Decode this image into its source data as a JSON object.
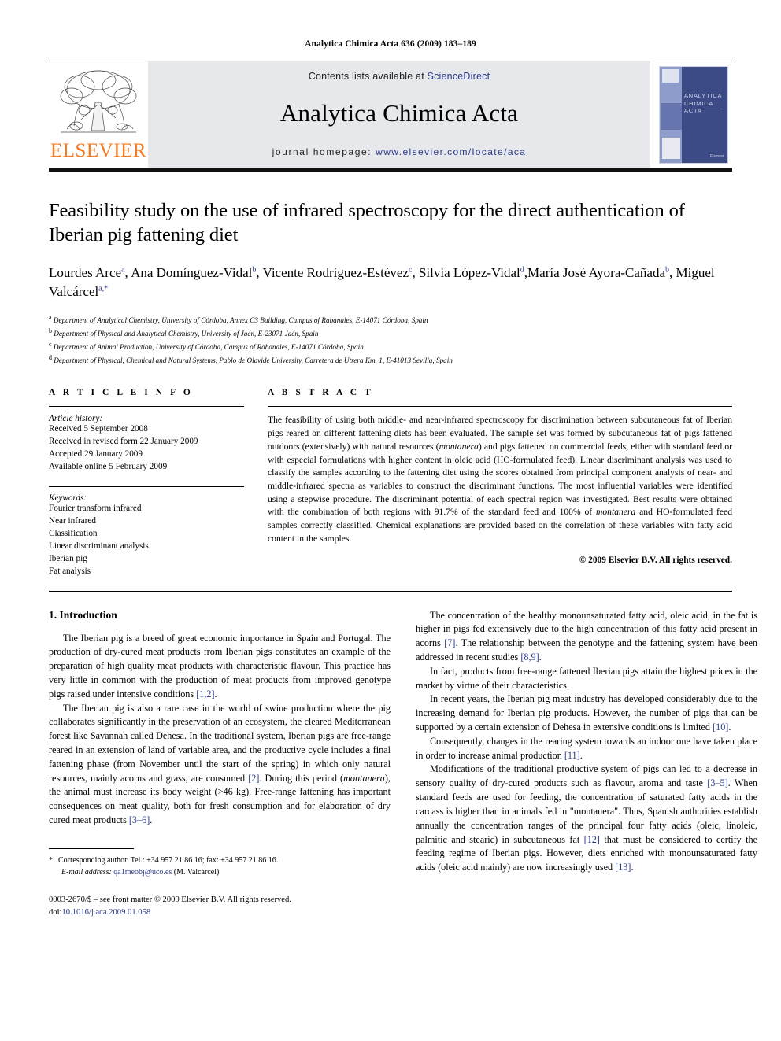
{
  "running_head": "Analytica Chimica Acta 636 (2009) 183–189",
  "masthead": {
    "publisher_wordmark": "ELSEVIER",
    "contents_prefix": "Contents lists available at ",
    "contents_link": "ScienceDirect",
    "journal_title": "Analytica Chimica Acta",
    "homepage_prefix": "journal homepage: ",
    "homepage_url": "www.elsevier.com/locate/aca",
    "cover_title": "ANALYTICA CHIMICA ACTA",
    "cover_brand": "Elsevier"
  },
  "article": {
    "title": "Feasibility study on the use of infrared spectroscopy for the direct authentication of Iberian pig fattening diet",
    "authors": [
      {
        "name": "Lourdes Arce",
        "marks": "a",
        "sep": ", "
      },
      {
        "name": "Ana Domínguez-Vidal",
        "marks": "b",
        "sep": ", "
      },
      {
        "name": "Vicente Rodríguez-Estévez",
        "marks": "c",
        "sep": ", "
      },
      {
        "name": "Silvia López-Vidal",
        "marks": "d",
        "sep": ","
      },
      {
        "name": "María José Ayora-Cañada",
        "marks": "b",
        "sep": ", "
      },
      {
        "name": "Miguel Valcárcel",
        "marks": "a,*",
        "sep": ""
      }
    ],
    "affiliations": [
      {
        "mark": "a",
        "text": "Department of Analytical Chemistry, University of Córdoba, Annex C3 Building, Campus of Rabanales, E-14071 Córdoba, Spain"
      },
      {
        "mark": "b",
        "text": "Department of Physical and Analytical Chemistry, University of Jaén, E-23071 Jaén, Spain"
      },
      {
        "mark": "c",
        "text": "Department of Animal Production, University of Córdoba, Campus of Rabanales, E-14071 Córdoba, Spain"
      },
      {
        "mark": "d",
        "text": "Department of Physical, Chemical and Natural Systems, Pablo de Olavide University, Carretera de Utrera Km. 1, E-41013 Sevilla, Spain"
      }
    ]
  },
  "article_info": {
    "heading": "A R T I C L E    I N F O",
    "history_label": "Article history:",
    "history": [
      "Received 5 September 2008",
      "Received in revised form 22 January 2009",
      "Accepted 29 January 2009",
      "Available online 5 February 2009"
    ],
    "keywords_label": "Keywords:",
    "keywords": [
      "Fourier transform infrared",
      "Near infrared",
      "Classification",
      "Linear discriminant analysis",
      "Iberian pig",
      "Fat analysis"
    ]
  },
  "abstract": {
    "heading": "A B S T R A C T",
    "text_part1": "The feasibility of using both middle- and near-infrared spectroscopy for discrimination between subcutaneous fat of Iberian pigs reared on different fattening diets has been evaluated. The sample set was formed by subcutaneous fat of pigs fattened outdoors (extensively) with natural resources (",
    "italic1": "montanera",
    "text_part2": ") and pigs fattened on commercial feeds, either with standard feed or with especial formulations with higher content in oleic acid (HO-formulated feed). Linear discriminant analysis was used to classify the samples according to the fattening diet using the scores obtained from principal component analysis of near- and middle-infrared spectra as variables to construct the discriminant functions. The most influential variables were identified using a stepwise procedure. The discriminant potential of each spectral region was investigated. Best results were obtained with the combination of both regions with 91.7% of the standard feed and 100% of ",
    "italic2": "montanera",
    "text_part3": " and HO-formulated feed samples correctly classified. Chemical explanations are provided based on the correlation of these variables with fatty acid content in the samples.",
    "copyright": "© 2009 Elsevier B.V. All rights reserved."
  },
  "introduction": {
    "heading": "1.  Introduction",
    "left_paragraphs": [
      {
        "segments": [
          {
            "t": "The Iberian pig is a breed of great economic importance in Spain and Portugal. The production of dry-cured meat products from Iberian pigs constitutes an example of the preparation of high quality meat products with characteristic flavour. This practice has very little in common with the production of meat products from improved genotype pigs raised under intensive conditions ",
            "k": "plain"
          },
          {
            "t": "[1,2]",
            "k": "ref"
          },
          {
            "t": ".",
            "k": "plain"
          }
        ]
      },
      {
        "segments": [
          {
            "t": "The Iberian pig is also a rare case in the world of swine production where the pig collaborates significantly in the preservation of an ecosystem, the cleared Mediterranean forest like Savannah called Dehesa. In the traditional system, Iberian pigs are free-range reared in an extension of land of variable area, and the productive cycle includes a final fattening phase (from November until the start of the spring) in which only natural resources, mainly acorns and grass, are consumed ",
            "k": "plain"
          },
          {
            "t": "[2]",
            "k": "ref"
          },
          {
            "t": ". During this period (",
            "k": "plain"
          },
          {
            "t": "montanera",
            "k": "italic"
          },
          {
            "t": "), the animal must increase its body weight (>46 kg). Free-range fattening has important consequences on meat quality, both for fresh consumption and for elaboration of dry cured meat products ",
            "k": "plain"
          },
          {
            "t": "[3–6]",
            "k": "ref"
          },
          {
            "t": ".",
            "k": "plain"
          }
        ]
      }
    ],
    "right_paragraphs": [
      {
        "segments": [
          {
            "t": "The concentration of the healthy monounsaturated fatty acid, oleic acid, in the fat is higher in pigs fed extensively due to the high concentration of this fatty acid present in acorns ",
            "k": "plain"
          },
          {
            "t": "[7]",
            "k": "ref"
          },
          {
            "t": ". The relationship between the genotype and the fattening system have been addressed in recent studies ",
            "k": "plain"
          },
          {
            "t": "[8,9]",
            "k": "ref"
          },
          {
            "t": ".",
            "k": "plain"
          }
        ]
      },
      {
        "segments": [
          {
            "t": "In fact, products from free-range fattened Iberian pigs attain the highest prices in the market by virtue of their characteristics.",
            "k": "plain"
          }
        ]
      },
      {
        "segments": [
          {
            "t": "In recent years, the Iberian pig meat industry has developed considerably due to the increasing demand for Iberian pig products. However, the number of pigs that can be supported by a certain extension of Dehesa in extensive conditions is limited ",
            "k": "plain"
          },
          {
            "t": "[10]",
            "k": "ref"
          },
          {
            "t": ".",
            "k": "plain"
          }
        ]
      },
      {
        "segments": [
          {
            "t": "Consequently, changes in the rearing system towards an indoor one have taken place in order to increase animal production ",
            "k": "plain"
          },
          {
            "t": "[11]",
            "k": "ref"
          },
          {
            "t": ".",
            "k": "plain"
          }
        ]
      },
      {
        "segments": [
          {
            "t": "Modifications of the traditional productive system of pigs can led to a decrease in sensory quality of dry-cured products such as flavour, aroma and taste ",
            "k": "plain"
          },
          {
            "t": "[3–5]",
            "k": "ref"
          },
          {
            "t": ". When standard feeds are used for feeding, the concentration of saturated fatty acids in the carcass is higher than in animals fed in \"montanera\". Thus, Spanish authorities establish annually the concentration ranges of the principal four fatty acids (oleic, linoleic, palmitic and stearic) in subcutaneous fat ",
            "k": "plain"
          },
          {
            "t": "[12]",
            "k": "ref"
          },
          {
            "t": " that must be considered to certify the feeding regime of Iberian pigs. However, diets enriched with monounsaturated fatty acids (oleic acid mainly) are now increasingly used ",
            "k": "plain"
          },
          {
            "t": "[13]",
            "k": "ref"
          },
          {
            "t": ".",
            "k": "plain"
          }
        ]
      }
    ]
  },
  "footnote": {
    "star": "*",
    "corresponding": "Corresponding author. Tel.: +34 957 21 86 16; fax: +34 957 21 86 16.",
    "email_label": "E-mail address:",
    "email": "qa1meobj@uco.es",
    "email_suffix": "(M. Valcárcel).",
    "issn_line": "0003-2670/$ – see front matter © 2009 Elsevier B.V. All rights reserved.",
    "doi_label": "doi:",
    "doi": "10.1016/j.aca.2009.01.058"
  }
}
